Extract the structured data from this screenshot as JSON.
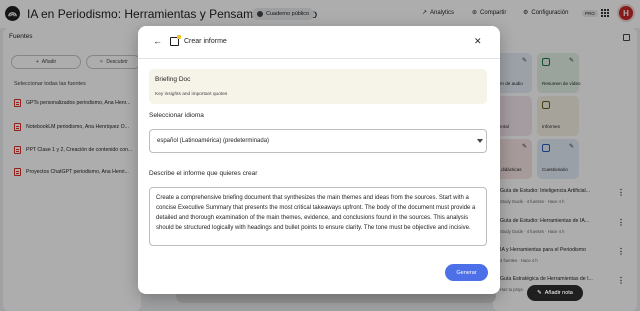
{
  "header": {
    "app_title": "IA en Periodismo: Herramientas y Pensamiento Crítico",
    "public_chip": "Cuaderno público",
    "analytics": "Analytics",
    "share": "Compartir",
    "settings": "Configuración",
    "pro": "PRO",
    "avatar_letter": "H"
  },
  "sources": {
    "title": "Fuentes",
    "add_label": "Añadir",
    "discover_label": "Descubrir",
    "select_all": "Seleccionar todas las fuentes",
    "items": [
      "GPTs personalizados periodismo, Ana Henr...",
      "NotebookLM periodismo, Ana Henriquez O...",
      "PPT Clase 1 y 2, Creación de contenido con...",
      "Proyectos ChatGPT periodismo, Ana Henri..."
    ]
  },
  "studio": {
    "cards": [
      "men de audio",
      "Resumen de vídeo",
      "mental",
      "Informes",
      "es didácticas",
      "Cuestionario"
    ],
    "notes": [
      {
        "title": "Guía de Estudio: Inteligencia Artificial...",
        "meta": "Study Guide · 4 fuentes · Hace 4 h"
      },
      {
        "title": "Guía de Estudio: Herramientas de IA...",
        "meta": "Study Guide · 4 fuentes · Hace 4 h"
      },
      {
        "title": "IA y Herramientas para el Periodismo",
        "meta": "4 fuentes · Hace 4 h"
      },
      {
        "title": "Guía Estratégica de Herramientas de I...",
        "meta": "Haz tu propi"
      }
    ],
    "add_note": "Añadir nota"
  },
  "modal": {
    "title": "Crear informe",
    "format": {
      "name": "Briefing Doc",
      "description": "Key insights and important quotes"
    },
    "language_label": "Seleccionar idioma",
    "language_value": "español (Latinoamérica) (predeterminada)",
    "description_label": "Describe el informe que quieres crear",
    "prompt_text": "Create a comprehensive briefing document that synthesizes the main themes and ideas from the sources. Start with a concise Executive Summary that presents the most critical takeaways upfront. The body of the document must provide a detailed and thorough examination of the main themes, evidence, and conclusions found in the sources. This analysis should be structured logically with headings and bullet points to ensure clarity. The tone must be objective and incisive.",
    "generate_label": "Generar"
  },
  "colors": {
    "accent_button": "#4d6fe8",
    "format_card_bg": "#f6f3e9",
    "avatar_bg": "#c62828"
  }
}
